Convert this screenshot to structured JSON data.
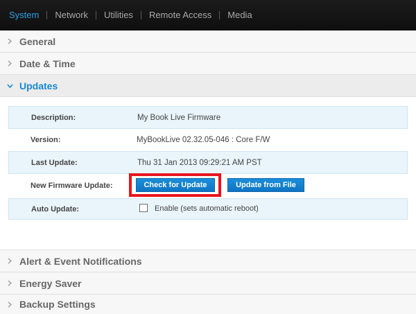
{
  "topnav": {
    "tabs": [
      {
        "label": "System",
        "active": true
      },
      {
        "label": "Network",
        "active": false
      },
      {
        "label": "Utilities",
        "active": false
      },
      {
        "label": "Remote Access",
        "active": false
      },
      {
        "label": "Media",
        "active": false
      }
    ]
  },
  "sections": {
    "general": "General",
    "date_time": "Date & Time",
    "updates": "Updates",
    "alerts": "Alert & Event Notifications",
    "energy": "Energy Saver",
    "backup": "Backup Settings"
  },
  "updates": {
    "description_label": "Description:",
    "description_value": "My Book Live Firmware",
    "version_label": "Version:",
    "version_value": "MyBookLive 02.32.05-046 : Core F/W",
    "last_update_label": "Last Update:",
    "last_update_value": "Thu 31 Jan 2013 09:29:21 AM PST",
    "new_fw_label": "New Firmware Update:",
    "check_button": "Check for Update",
    "file_button": "Update from File",
    "auto_update_label": "Auto Update:",
    "auto_update_checkbox_label": "Enable (sets automatic reboot)",
    "auto_update_checked": false
  },
  "colors": {
    "accent": "#1787d8",
    "nav_bg": "#141414",
    "highlight": "#e8141c"
  }
}
